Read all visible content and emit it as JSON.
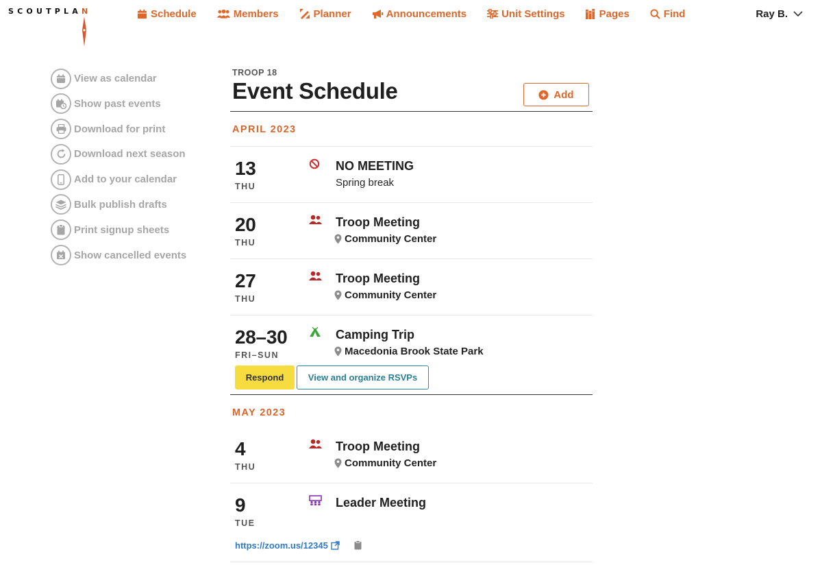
{
  "app": {
    "logo_main": "SCOUTPLA",
    "logo_end": "N"
  },
  "nav": [
    {
      "label": "Schedule",
      "icon": "calendar-icon"
    },
    {
      "label": "Members",
      "icon": "members-icon"
    },
    {
      "label": "Planner",
      "icon": "planner-icon"
    },
    {
      "label": "Announcements",
      "icon": "megaphone-icon"
    },
    {
      "label": "Unit Settings",
      "icon": "sliders-icon"
    },
    {
      "label": "Pages",
      "icon": "pages-icon"
    },
    {
      "label": "Find",
      "icon": "search-icon"
    }
  ],
  "user": {
    "name": "Ray B."
  },
  "sidebar": [
    {
      "label": "View as calendar",
      "icon": "calendar-icon"
    },
    {
      "label": "Show past events",
      "icon": "calendar-clock-icon"
    },
    {
      "label": "Download for print",
      "icon": "printer-icon"
    },
    {
      "label": "Download next season",
      "icon": "refresh-icon"
    },
    {
      "label": "Add to your calendar",
      "icon": "phone-icon"
    },
    {
      "label": "Bulk publish drafts",
      "icon": "layers-icon"
    },
    {
      "label": "Print signup sheets",
      "icon": "clipboard-icon"
    },
    {
      "label": "Show cancelled events",
      "icon": "calendar-x-icon"
    }
  ],
  "main": {
    "troop": "TROOP 18",
    "title": "Event Schedule",
    "add_label": "Add"
  },
  "months": [
    {
      "label": "APRIL 2023",
      "events": [
        {
          "day": "13",
          "dow": "THU",
          "title": "NO MEETING",
          "subtitle": "Spring break",
          "icon": "no-meeting-icon"
        },
        {
          "day": "20",
          "dow": "THU",
          "title": "Troop Meeting",
          "location": "Community Center",
          "icon": "troop-meeting-icon"
        },
        {
          "day": "27",
          "dow": "THU",
          "title": "Troop Meeting",
          "location": "Community Center",
          "icon": "troop-meeting-icon"
        },
        {
          "day": "28–30",
          "dow": "FRI–SUN",
          "title": "Camping Trip",
          "location": "Macedonia Brook State Park",
          "icon": "tent-icon",
          "respond_label": "Respond",
          "rsvp_label": "View and organize RSVPs"
        }
      ]
    },
    {
      "label": "MAY 2023",
      "events": [
        {
          "day": "4",
          "dow": "THU",
          "title": "Troop Meeting",
          "location": "Community Center",
          "icon": "troop-meeting-icon"
        },
        {
          "day": "9",
          "dow": "TUE",
          "title": "Leader Meeting",
          "icon": "leader-meeting-icon",
          "link": "https://zoom.us/12345"
        }
      ]
    }
  ],
  "colors": {
    "accent": "#e0672a",
    "muted": "#a6a6a6",
    "cancel": "#cc2f2f",
    "troop_icon": "#b32a2a",
    "camping_icon": "#3aa63a",
    "leader_icon": "#8a2fb3",
    "respond_bg": "#f7dc3f",
    "rsvp": "#2a7f94",
    "link": "#2f79c6"
  }
}
